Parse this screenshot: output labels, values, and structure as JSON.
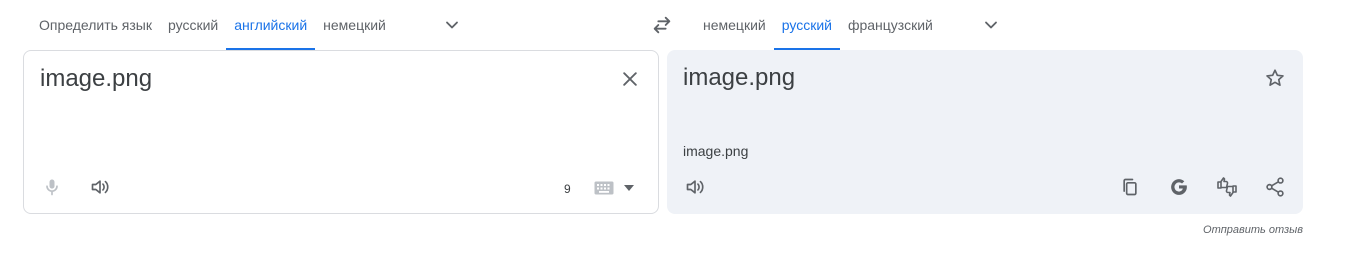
{
  "source_tabs": [
    {
      "label": "Определить язык",
      "active": false
    },
    {
      "label": "русский",
      "active": false
    },
    {
      "label": "английский",
      "active": true
    },
    {
      "label": "немецкий",
      "active": false
    }
  ],
  "target_tabs": [
    {
      "label": "немецкий",
      "active": false
    },
    {
      "label": "русский",
      "active": true
    },
    {
      "label": "французский",
      "active": false
    }
  ],
  "source": {
    "text": "image.png",
    "char_count": "9",
    "icons": [
      "close-icon",
      "microphone-icon",
      "speaker-icon",
      "keyboard-icon",
      "caret-down-icon"
    ]
  },
  "target": {
    "text": "image.png",
    "transliteration": "image.png",
    "icons": [
      "star-icon",
      "speaker-icon",
      "copy-icon",
      "google-icon",
      "feedback-thumbs-icon",
      "share-icon"
    ]
  },
  "icons": {
    "swap": "swap-arrows-icon",
    "more_languages": "chevron-down-icon"
  },
  "footer": {
    "feedback_label": "Отправить отзыв"
  },
  "colors": {
    "accent": "#1a73e8",
    "target_bg": "#eff2f7",
    "border": "#dadce0",
    "text": "#3c4043",
    "muted": "#5f6368"
  }
}
